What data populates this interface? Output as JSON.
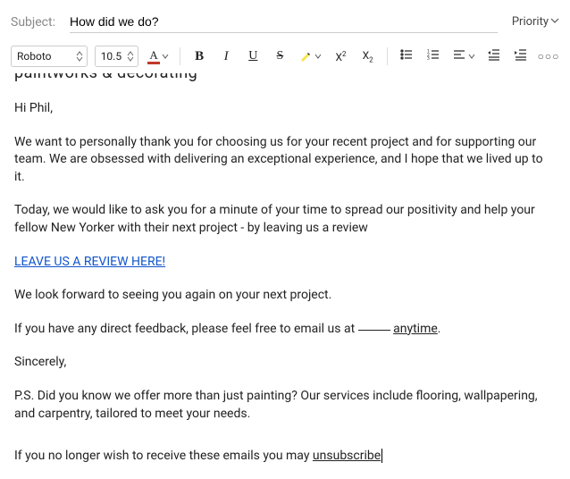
{
  "subject": {
    "label": "Subject:",
    "value": "How did we do?"
  },
  "priority": {
    "label": "Priority"
  },
  "toolbar": {
    "font_family": "Roboto",
    "font_size": "10.5",
    "text_color": "#c0392b",
    "highlight_color": "#f9e547"
  },
  "body": {
    "cut_line": "paintworks & decorating",
    "greeting": "Hi Phil,",
    "p1": "We want to personally thank you for choosing us for your recent project and for supporting our team. We are obsessed with delivering an exceptional experience, and I hope that we lived up to it.",
    "p2": "Today, we would like to ask you for a minute of your time to spread our positivity and help your fellow New Yorker with their next project - by leaving us a review",
    "review_link": "LEAVE US A REVIEW HERE!",
    "p3": "We look forward to seeing you again on your next project.",
    "p4_a": "If you have any direct feedback, please feel free to email us at ",
    "p4_b": " ",
    "anytime": "anytime",
    "p4_c": ".",
    "signoff": "Sincerely,",
    "ps": "P.S. Did you know we offer more than just painting? Our services include flooring, wallpapering, and carpentry, tailored to meet your needs.",
    "unsub_a": "If you no longer wish to receive these emails you may ",
    "unsub_b": "unsubscribe"
  }
}
